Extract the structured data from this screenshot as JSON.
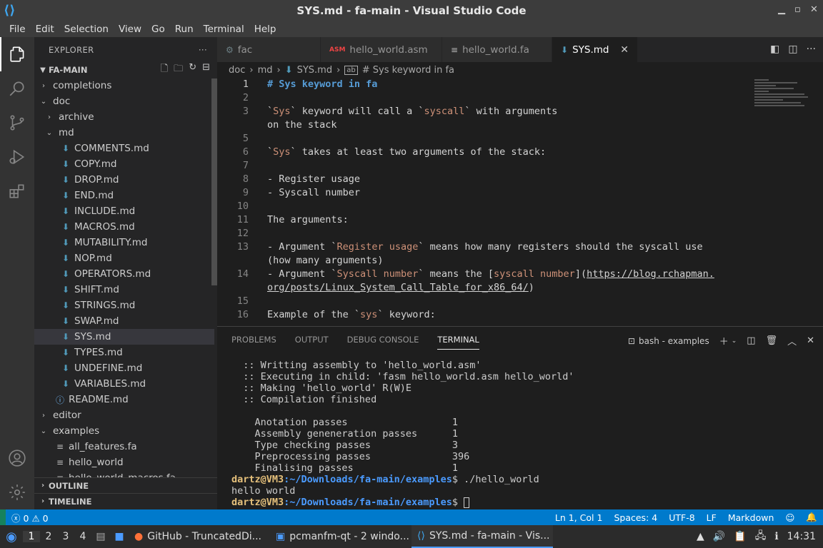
{
  "window": {
    "title": "SYS.md - fa-main - Visual Studio Code"
  },
  "menu": [
    "File",
    "Edit",
    "Selection",
    "View",
    "Go",
    "Run",
    "Terminal",
    "Help"
  ],
  "activity": [
    "explorer-icon",
    "search-icon",
    "source-control-icon",
    "run-debug-icon",
    "extensions-icon",
    "accounts-icon",
    "manage-gear-icon"
  ],
  "sidebar": {
    "title": "EXPLORER",
    "root": "FA-MAIN",
    "tree": [
      {
        "label": "completions",
        "kind": "folder",
        "open": false,
        "indent": 1
      },
      {
        "label": "doc",
        "kind": "folder",
        "open": true,
        "indent": 1
      },
      {
        "label": "archive",
        "kind": "folder",
        "open": false,
        "indent": 2
      },
      {
        "label": "md",
        "kind": "folder",
        "open": true,
        "indent": 2
      },
      {
        "label": "COMMENTS.md",
        "kind": "md",
        "indent": 3
      },
      {
        "label": "COPY.md",
        "kind": "md",
        "indent": 3
      },
      {
        "label": "DROP.md",
        "kind": "md",
        "indent": 3
      },
      {
        "label": "END.md",
        "kind": "md",
        "indent": 3
      },
      {
        "label": "INCLUDE.md",
        "kind": "md",
        "indent": 3
      },
      {
        "label": "MACROS.md",
        "kind": "md",
        "indent": 3
      },
      {
        "label": "MUTABILITY.md",
        "kind": "md",
        "indent": 3
      },
      {
        "label": "NOP.md",
        "kind": "md",
        "indent": 3
      },
      {
        "label": "OPERATORS.md",
        "kind": "md",
        "indent": 3
      },
      {
        "label": "SHIFT.md",
        "kind": "md",
        "indent": 3
      },
      {
        "label": "STRINGS.md",
        "kind": "md",
        "indent": 3
      },
      {
        "label": "SWAP.md",
        "kind": "md",
        "indent": 3
      },
      {
        "label": "SYS.md",
        "kind": "md",
        "indent": 3,
        "selected": true
      },
      {
        "label": "TYPES.md",
        "kind": "md",
        "indent": 3
      },
      {
        "label": "UNDEFINE.md",
        "kind": "md",
        "indent": 3
      },
      {
        "label": "VARIABLES.md",
        "kind": "md",
        "indent": 3
      },
      {
        "label": "README.md",
        "kind": "info",
        "indent": 2
      },
      {
        "label": "editor",
        "kind": "folder",
        "open": false,
        "indent": 1
      },
      {
        "label": "examples",
        "kind": "folder",
        "open": true,
        "indent": 1
      },
      {
        "label": "all_features.fa",
        "kind": "fa",
        "indent": 2
      },
      {
        "label": "hello_world",
        "kind": "fa",
        "indent": 2
      },
      {
        "label": "hello_world_macros.fa",
        "kind": "fa",
        "indent": 2
      }
    ],
    "outline": "OUTLINE",
    "timeline": "TIMELINE"
  },
  "tabs": [
    {
      "label": "fac",
      "icon": "gear-file-icon",
      "active": false
    },
    {
      "label": "hello_world.asm",
      "icon": "asm-file-icon",
      "active": false
    },
    {
      "label": "hello_world.fa",
      "icon": "lines-file-icon",
      "active": false
    },
    {
      "label": "SYS.md",
      "icon": "markdown-file-icon",
      "active": true
    }
  ],
  "breadcrumb": [
    "doc",
    "md",
    "SYS.md",
    "# Sys keyword in fa"
  ],
  "code": [
    {
      "n": "1",
      "t": "# Sys keyword in fa"
    },
    {
      "n": "2",
      "t": ""
    },
    {
      "n": "3",
      "t": "`Sys` keyword will call a `syscall` with arguments"
    },
    {
      "n": "",
      "t": "on the stack"
    },
    {
      "n": "5",
      "t": ""
    },
    {
      "n": "6",
      "t": "`Sys` takes at least two arguments of the stack:"
    },
    {
      "n": "7",
      "t": ""
    },
    {
      "n": "8",
      "t": "- Register usage"
    },
    {
      "n": "9",
      "t": "- Syscall number"
    },
    {
      "n": "10",
      "t": ""
    },
    {
      "n": "11",
      "t": "The arguments:"
    },
    {
      "n": "12",
      "t": ""
    },
    {
      "n": "13",
      "t": "- Argument `Register usage` means how many registers should the syscall use"
    },
    {
      "n": "",
      "t": "(how many arguments)"
    },
    {
      "n": "14",
      "t": "- Argument `Syscall number` means the [syscall number](https://blog.rchapman."
    },
    {
      "n": "",
      "t": "org/posts/Linux_System_Call_Table_for_x86_64/)"
    },
    {
      "n": "15",
      "t": ""
    },
    {
      "n": "16",
      "t": "Example of the `sys` keyword:"
    }
  ],
  "panel": {
    "tabs": [
      "PROBLEMS",
      "OUTPUT",
      "DEBUG CONSOLE",
      "TERMINAL"
    ],
    "active": "TERMINAL",
    "terminal_name": "bash - examples",
    "lines": [
      "  :: Writting assembly to 'hello_world.asm'",
      "  :: Executing in child: 'fasm hello_world.asm hello_world'",
      "  :: Making 'hello_world' R(W)E",
      "  :: Compilation finished",
      "",
      "    Anotation passes                  1",
      "    Assembly geneneration passes      1",
      "    Type checking passes              3",
      "    Preprocessing passes              396",
      "    Finalising passes                 1"
    ],
    "prompt1": {
      "user": "dartz@VM3",
      "path": ":~/Downloads/fa-main/examples",
      "cmd": "$ ./hello_world"
    },
    "output": "hello world",
    "prompt2": {
      "user": "dartz@VM3",
      "path": ":~/Downloads/fa-main/examples",
      "cmd": "$ "
    }
  },
  "status": {
    "errors": "0",
    "warnings": "0",
    "position": "Ln 1, Col 1",
    "spaces": "Spaces: 4",
    "encoding": "UTF-8",
    "eol": "LF",
    "language": "Markdown"
  },
  "taskbar": {
    "workspaces": [
      "1",
      "2",
      "3",
      "4"
    ],
    "apps": [
      "GitHub - TruncatedDi...",
      "pcmanfm-qt - 2 windo...",
      "SYS.md - fa-main - Vis..."
    ],
    "clock": "14:31"
  }
}
